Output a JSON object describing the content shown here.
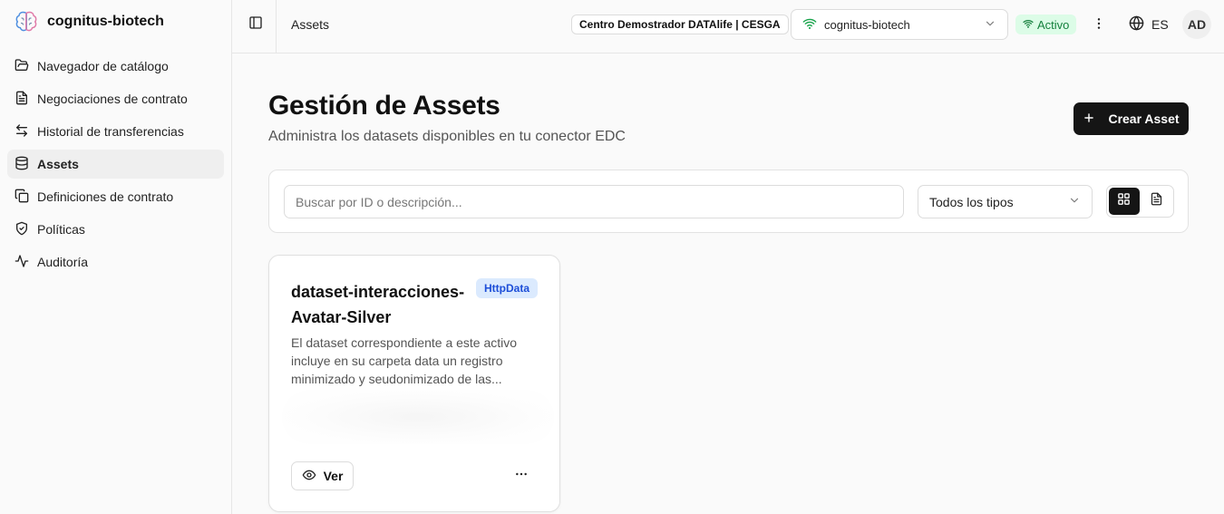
{
  "brand": {
    "name": "cognitus-biotech",
    "logo_icon": "brain-logo-icon"
  },
  "sidebar": {
    "items": [
      {
        "label": "Navegador de catálogo",
        "icon": "folder-open-icon",
        "active": false
      },
      {
        "label": "Negociaciones de contrato",
        "icon": "file-text-icon",
        "active": false
      },
      {
        "label": "Historial de transferencias",
        "icon": "arrows-left-right-icon",
        "active": false
      },
      {
        "label": "Assets",
        "icon": "database-icon",
        "active": true
      },
      {
        "label": "Definiciones de contrato",
        "icon": "copy-icon",
        "active": false
      },
      {
        "label": "Políticas",
        "icon": "shield-check-icon",
        "active": false
      },
      {
        "label": "Auditoría",
        "icon": "activity-icon",
        "active": false
      }
    ]
  },
  "topbar": {
    "breadcrumb": "Assets",
    "org_badge": "Centro Demostrador DATAlife | CESGA",
    "connector_select": "cognitus-biotech",
    "status": "Activo",
    "language": "ES",
    "avatar_initials": "AD"
  },
  "main": {
    "title": "Gestión de Assets",
    "subtitle": "Administra los datasets disponibles en tu conector EDC",
    "create_button": "Crear Asset",
    "search_placeholder": "Buscar por ID o descripción...",
    "type_filter": "Todos los tipos",
    "view_mode": "grid"
  },
  "assets": [
    {
      "title": "dataset-interacciones-Avatar-Silver",
      "type": "HttpData",
      "description": "El dataset correspondiente a este activo incluye en su carpeta data un registro minimizado y seudonimizado de las...",
      "view_label": "Ver"
    }
  ],
  "colors": {
    "primary_dark": "#151515",
    "status_green_bg": "#dcfce7",
    "status_green_text": "#15803d",
    "type_badge_bg": "#dbeafe",
    "type_badge_text": "#1d4ed8"
  }
}
